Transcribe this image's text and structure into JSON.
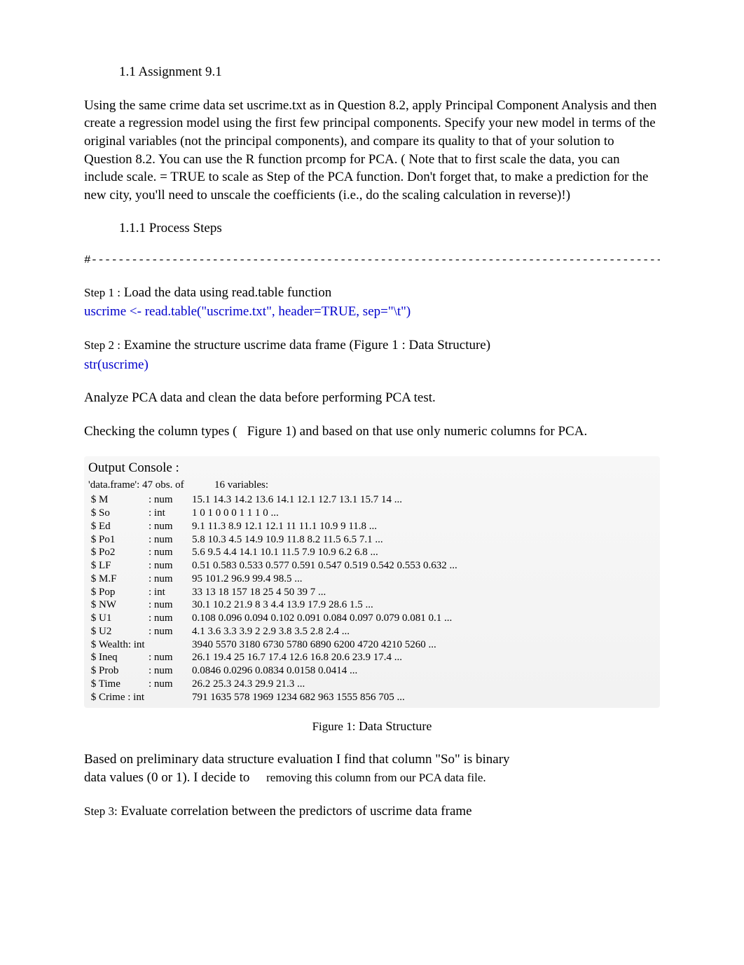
{
  "section_heading": "1.1 Assignment 9.1",
  "intro_paragraph": "Using the same crime data set uscrime.txt as in Question 8.2, apply Principal Component Analysis and then create a regression model using the first few principal components. Specify your new model in terms of the original variables (not the principal components), and compare its quality to that of your solution to Question 8.2. You can use the R function prcomp for PCA. (        Note  that to first scale the data, you can include scale. = TRUE to scale as Step of the PCA function. Don't forget that, to make a prediction for the new city, you'll need to unscale the coefficients (i.e., do the scaling calculation in reverse)!)",
  "sub_heading": "1.1.1 Process Steps",
  "hr_text": "#------------------------------------------------------------------------------------------",
  "step1": {
    "label": "Step 1 :",
    "text": "  Load the data using read.table function",
    "code": "uscrime <- read.table(\"uscrime.txt\", header=TRUE, sep=\"\\t\")"
  },
  "step2": {
    "label": "Step 2 :",
    "text": "  Examine the structure uscrime data frame (Figure 1 : Data Structure)",
    "code": "str(uscrime)"
  },
  "analyze_text": "Analyze PCA data and clean the data before performing PCA test.",
  "checking": {
    "pre": "Checking the column types (",
    "fig": "Figure 1",
    "post": ")  and based on that use only numeric columns for PCA."
  },
  "console": {
    "title": "Output Console  :",
    "header_left": "'data.frame': 47 obs. of",
    "header_right": "16 variables:",
    "rows": [
      {
        "name": " $ M",
        "type": ": num",
        "vals": "15.1 14.3 14.2 13.6 14.1 12.1 12.7 13.1 15.7 14 ..."
      },
      {
        "name": " $ So",
        "type": ": int",
        "vals": "1 0 1 0 0 0 1 1 1 0 ..."
      },
      {
        "name": " $ Ed",
        "type": ": num",
        "vals": "9.1 11.3 8.9 12.1 12.1 11 11.1 10.9 9 11.8 ..."
      },
      {
        "name": " $ Po1",
        "type": ": num",
        "vals": "5.8 10.3 4.5 14.9 10.9 11.8 8.2 11.5 6.5 7.1 ..."
      },
      {
        "name": " $ Po2",
        "type": ": num",
        "vals": "5.6 9.5 4.4 14.1 10.1 11.5 7.9 10.9 6.2 6.8 ..."
      },
      {
        "name": " $ LF",
        "type": ": num",
        "vals": "0.51 0.583 0.533 0.577 0.591 0.547 0.519 0.542 0.553 0.632 ..."
      },
      {
        "name": " $ M.F",
        "type": ": num",
        "vals": "95 101.2 96.9 99.4 98.5 ..."
      },
      {
        "name": " $ Pop",
        "type": ": int",
        "vals": "33 13 18 157 18 25 4 50 39 7 ..."
      },
      {
        "name": " $ NW",
        "type": ": num",
        "vals": "30.1 10.2 21.9 8 3 4.4 13.9 17.9 28.6 1.5 ..."
      },
      {
        "name": " $ U1",
        "type": ": num",
        "vals": "0.108 0.096 0.094 0.102 0.091 0.084 0.097 0.079 0.081 0.1 ..."
      },
      {
        "name": " $ U2",
        "type": ": num",
        "vals": "4.1 3.6 3.3 3.9 2 2.9 3.8 3.5 2.8 2.4 ..."
      },
      {
        "name": " $ Wealth",
        "type": ": int",
        "vals": "3940 5570 3180 6730 5780 6890 6200 4720 4210 5260 ..."
      },
      {
        "name": " $ Ineq",
        "type": ": num",
        "vals": "26.1 19.4 25 16.7 17.4 12.6 16.8 20.6 23.9 17.4 ..."
      },
      {
        "name": " $ Prob",
        "type": ": num",
        "vals": "0.0846 0.0296 0.0834 0.0158 0.0414 ..."
      },
      {
        "name": " $ Time",
        "type": ": num",
        "vals": "26.2 25.3 24.3 29.9 21.3 ..."
      },
      {
        "name": " $ Crime",
        "type": ": int",
        "vals": "791 1635 578 1969 1234 682 963 1555 856 705 ..."
      }
    ]
  },
  "figure_caption": {
    "label": "Figure 1:",
    "text": "   Data Structure"
  },
  "prelim": {
    "line1": "Based on preliminary data structure evaluation I find that column \"So\" is binary",
    "line2_a": "data values (0 or 1). I decide to",
    "line2_b": "removing this column from our PCA data file."
  },
  "step3": {
    "label": "Step 3:",
    "text": "  Evaluate correlation between the predictors of uscrime data frame"
  }
}
